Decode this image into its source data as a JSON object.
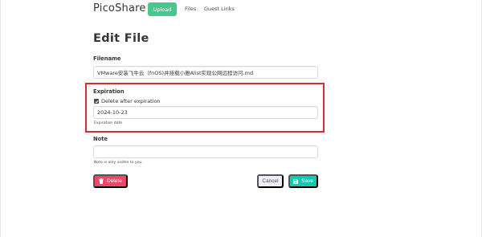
{
  "nav": {
    "brand": "PicoShare",
    "upload_label": "Upload",
    "files_label": "Files",
    "guest_links_label": "Guest Links"
  },
  "page": {
    "title": "Edit File"
  },
  "form": {
    "filename": {
      "label": "Filename",
      "value": "VMware安装飞牛云（fnOS)并挂载小雅Alist实现公网远程访问.md"
    },
    "expiration": {
      "label": "Expiration",
      "checkbox_label": "Delete after expiration",
      "checked": true,
      "date_value": "2024-10-23",
      "help": "Expiration date"
    },
    "note": {
      "label": "Note",
      "value": "",
      "help": "Note is only visible to you."
    }
  },
  "actions": {
    "delete_label": "Delete",
    "cancel_label": "Cancel",
    "save_label": "Save"
  },
  "colors": {
    "upload": "#48c78e",
    "delete": "#f14668",
    "save": "#00d1b2",
    "cancel": "#eeeef8",
    "highlight_border": "#d42e2e"
  },
  "icons": {
    "delete": "trash-icon",
    "save": "floppy-disk-icon",
    "checkbox": "checkmark-icon"
  }
}
